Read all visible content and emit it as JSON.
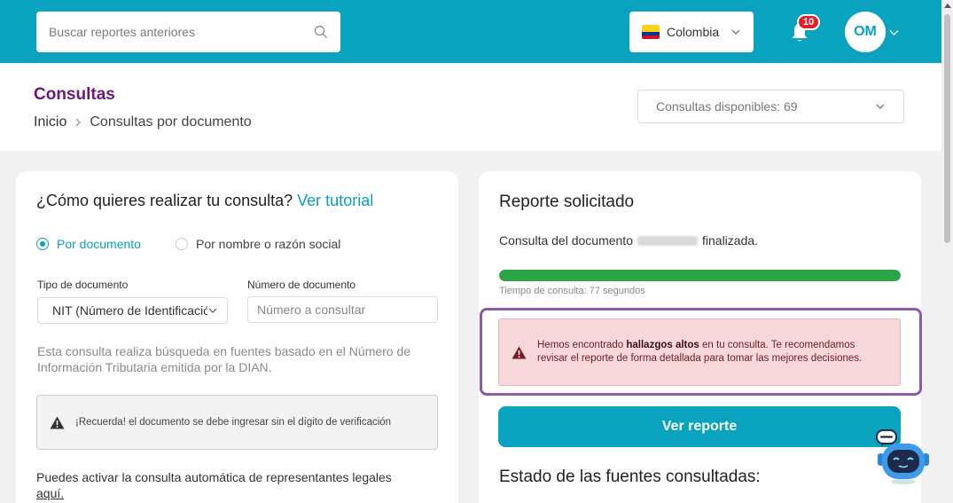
{
  "header": {
    "search_placeholder": "Buscar reportes anteriores",
    "country": "Colombia",
    "notifications_count": "10",
    "avatar_initials": "OM"
  },
  "page": {
    "title": "Consultas",
    "breadcrumb": [
      "Inicio",
      "Consultas por documento"
    ],
    "available": "Consultas disponibles: 69"
  },
  "left": {
    "question": "¿Cómo quieres realizar tu consulta?",
    "tutorial_link": "Ver tutorial",
    "radio_doc": "Por documento",
    "radio_name": "Por nombre o razón social",
    "doc_type_label": "Tipo de documento",
    "doc_type_value": "NIT (Número de Identificación Tributaria)",
    "doc_number_label": "Número de documento",
    "doc_number_placeholder": "Número a consultar",
    "description": "Esta consulta realiza búsqueda en fuentes basado en el Número de Información Tributaria emitida por la DIAN.",
    "notice": "¡Recuerda! el documento se debe ingresar sin el dígito de verificación",
    "auto_text": "Puedes activar la consulta automática de representantes legales",
    "auto_link": "aquí."
  },
  "right": {
    "title": "Reporte solicitado",
    "status_prefix": "Consulta del documento",
    "status_suffix": "finalizada.",
    "progress_percent": 100,
    "time_text": "Tiempo de consulta: 77 segundos",
    "alert_pre": "Hemos encontrado",
    "alert_bold": "hallazgos altos",
    "alert_post": "en tu consulta. Te recomendamos revisar el reporte de forma detallada para tomar las mejores decisiones.",
    "button": "Ver reporte",
    "sources_title": "Estado de las fuentes consultadas:"
  },
  "colors": {
    "brand": "#0aa3bf",
    "title_purple": "#6a1b7a",
    "progress_green": "#2aa446",
    "alert_bg": "#f8d7da",
    "highlight": "#8c5ba8"
  }
}
